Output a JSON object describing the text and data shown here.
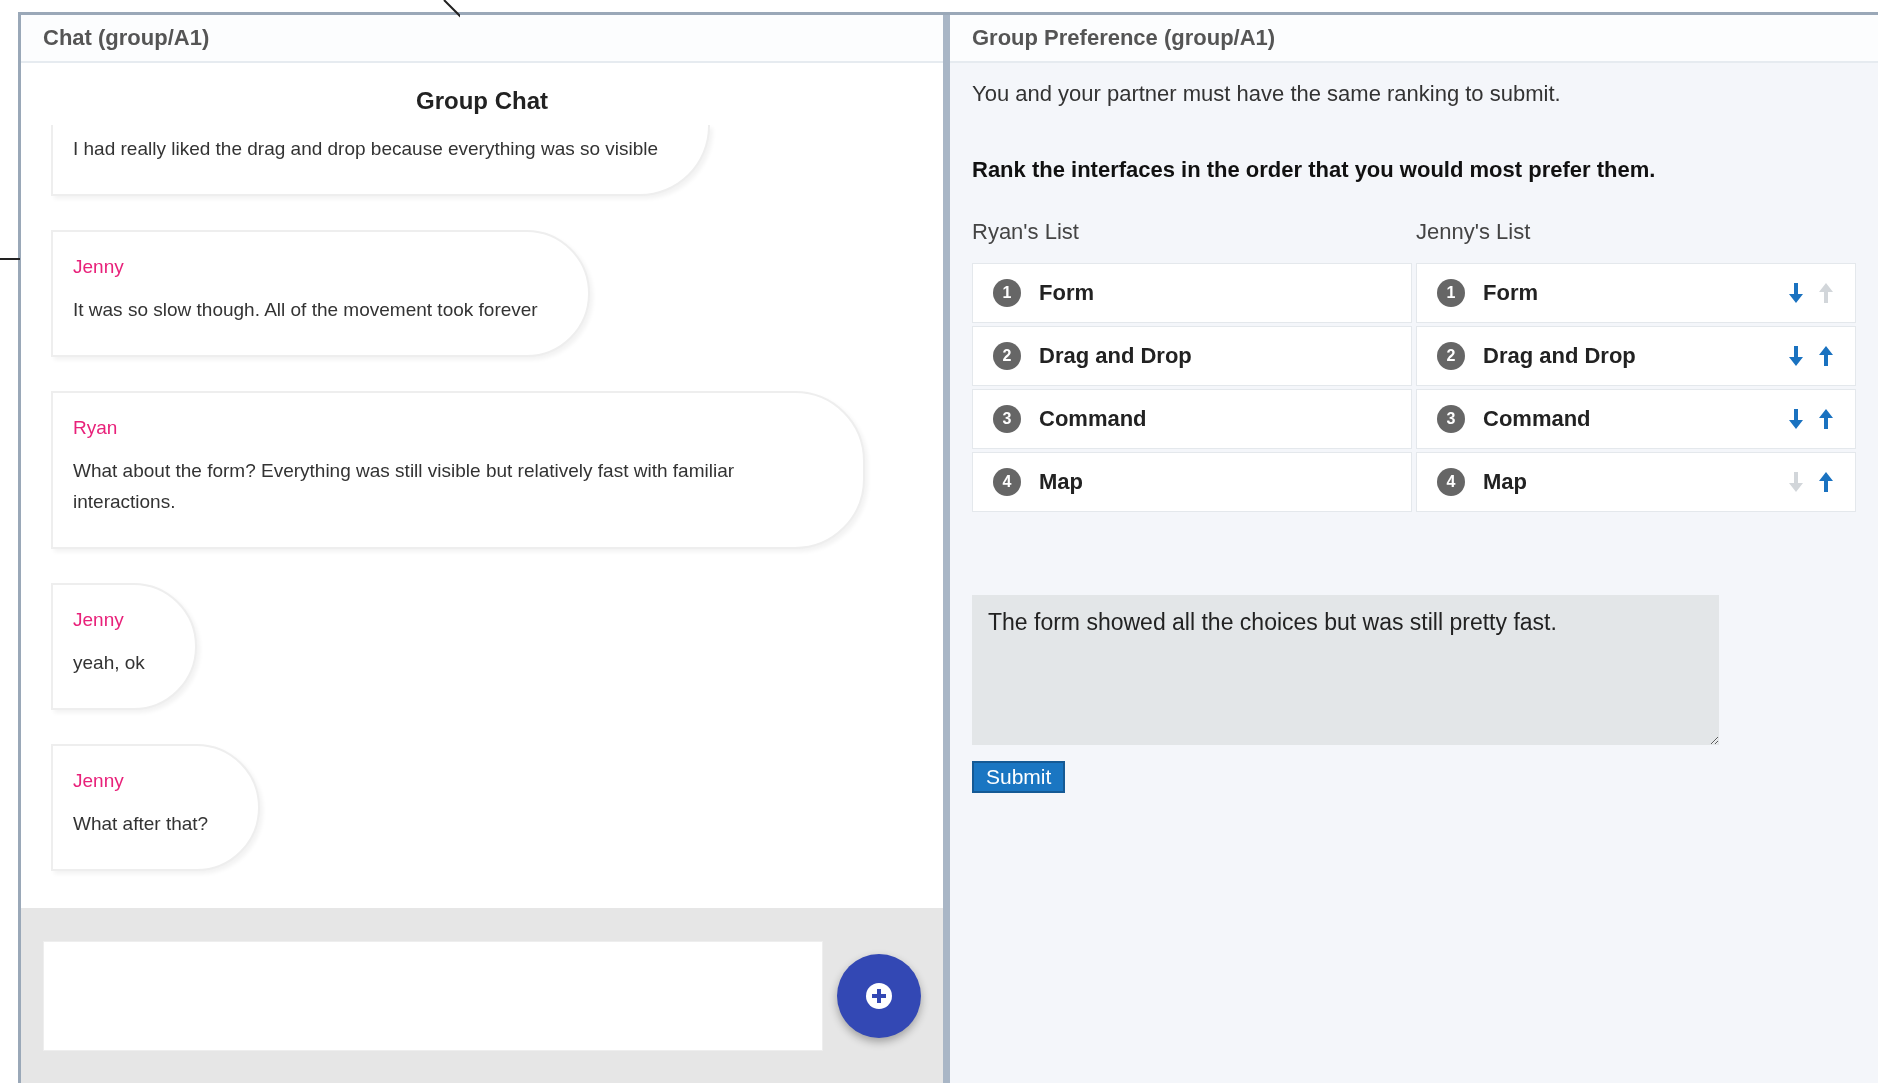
{
  "chat": {
    "title": "Chat (group/A1)",
    "heading": "Group Chat",
    "messages": [
      {
        "text": "I had really liked the drag and drop because everything was so visible"
      },
      {
        "sender": "Jenny",
        "text": "It was so slow though. All of the movement took forever"
      },
      {
        "sender": "Ryan",
        "text": "What about the form? Everything was still visible but relatively fast with familiar interactions."
      },
      {
        "sender": "Jenny",
        "text": "yeah, ok"
      },
      {
        "sender": "Jenny",
        "text": "What after that?"
      }
    ]
  },
  "preference": {
    "title": "Group Preference (group/A1)",
    "note": "You and your partner must have the same ranking to submit.",
    "instruction": "Rank the interfaces in the order that you would most prefer them.",
    "lists": [
      {
        "label": "Ryan's List",
        "editable": false,
        "items": [
          {
            "rank": "1",
            "name": "Form"
          },
          {
            "rank": "2",
            "name": "Drag and Drop"
          },
          {
            "rank": "3",
            "name": "Command"
          },
          {
            "rank": "4",
            "name": "Map"
          }
        ]
      },
      {
        "label": "Jenny's List",
        "editable": true,
        "items": [
          {
            "rank": "1",
            "name": "Form",
            "down_enabled": true,
            "up_enabled": false
          },
          {
            "rank": "2",
            "name": "Drag and Drop",
            "down_enabled": true,
            "up_enabled": true
          },
          {
            "rank": "3",
            "name": "Command",
            "down_enabled": true,
            "up_enabled": true
          },
          {
            "rank": "4",
            "name": "Map",
            "down_enabled": false,
            "up_enabled": true
          }
        ]
      }
    ],
    "comment": {
      "value": "The form showed all the choices but was still pretty fast."
    },
    "submit": "Submit"
  }
}
